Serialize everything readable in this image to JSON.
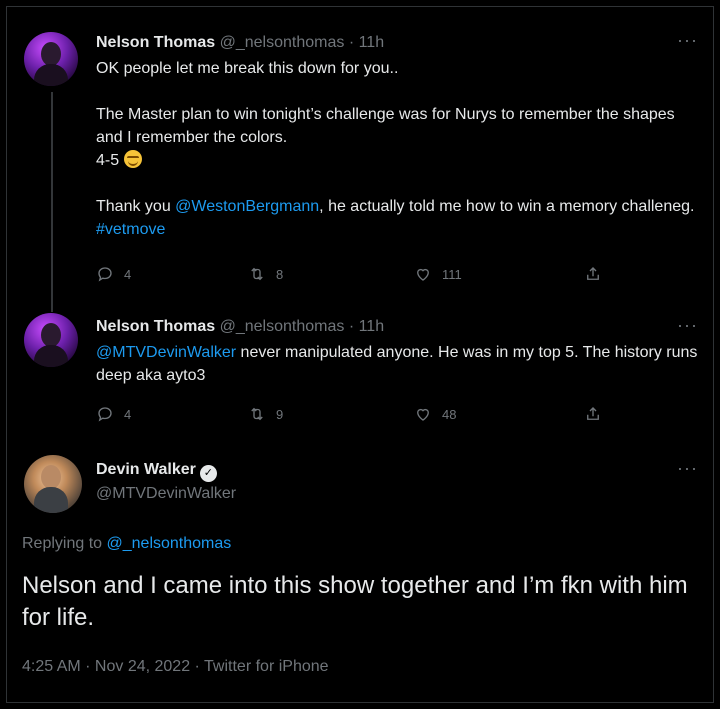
{
  "tweet1": {
    "name": "Nelson Thomas",
    "handle": "@_nelsonthomas",
    "time": "· 11h",
    "more": "···",
    "line1": "OK people let me break this down for you..",
    "line2": "The Master plan to win tonight’s challenge was for Nurys  to remember the shapes and I remember the colors.",
    "line3": "4-5",
    "line4_prefix": "Thank you ",
    "mention": "@WestonBergmann",
    "line4_suffix": ", he actually told me how to win a memory challeneg. ",
    "hashtag": "#vetmove",
    "replies": "4",
    "retweets": "8",
    "likes": "111"
  },
  "tweet2": {
    "name": "Nelson Thomas",
    "handle": "@_nelsonthomas",
    "time": "· 11h",
    "more": "···",
    "mention": "@MTVDevinWalker",
    "text": " never manipulated  anyone. He was in my top 5. The history runs deep aka ayto3",
    "replies": "4",
    "retweets": "9",
    "likes": "48"
  },
  "tweet3": {
    "name": "Devin Walker",
    "verified_mark": "✓",
    "handle": "@MTVDevinWalker",
    "more": "···",
    "replying_prefix": "Replying to ",
    "replying_handle": "@_nelsonthomas",
    "text": "Nelson and I came into this show together and I’m fkn with him for life.",
    "meta": "4:25 AM · Nov 24, 2022 · Twitter for iPhone"
  },
  "colors": {
    "link": "#1d9bf0",
    "muted": "#71767b",
    "background": "#000000"
  }
}
